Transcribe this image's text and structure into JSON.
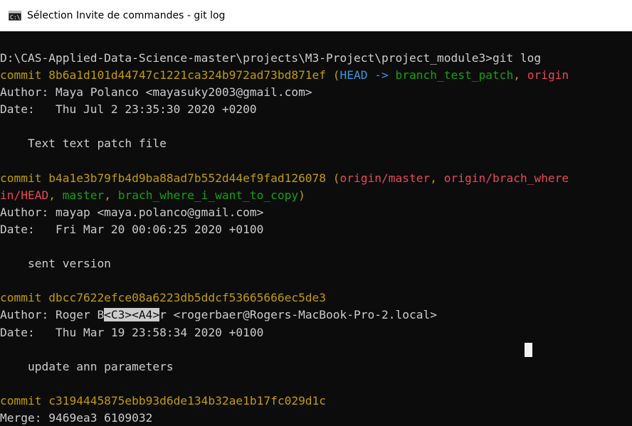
{
  "window": {
    "title": "Sélection Invite de commandes - git  log",
    "icon": "cmd-icon"
  },
  "console": {
    "lines": [
      {
        "segments": [
          {
            "text": "D:\\CAS-Applied-Data-Science-master\\projects\\M3-Project\\project_module3>git log",
            "color": "gray"
          }
        ]
      },
      {
        "segments": [
          {
            "text": "commit 8b6a1d101d44747c1221ca324b972ad73bd871ef ",
            "color": "yellow"
          },
          {
            "text": "(",
            "color": "yellow"
          },
          {
            "text": "HEAD -> ",
            "color": "cyan"
          },
          {
            "text": "branch_test_patch",
            "color": "green"
          },
          {
            "text": ", ",
            "color": "yellow"
          },
          {
            "text": "origin",
            "color": "red"
          }
        ]
      },
      {
        "segments": [
          {
            "text": "Author: Maya Polanco <mayasuky2003@gmail.com>",
            "color": "gray"
          }
        ]
      },
      {
        "segments": [
          {
            "text": "Date:   Thu Jul 2 23:35:30 2020 +0200",
            "color": "gray"
          }
        ]
      },
      {
        "segments": [
          {
            "text": "",
            "color": "gray"
          }
        ]
      },
      {
        "segments": [
          {
            "text": "    Text text patch file",
            "color": "gray"
          }
        ]
      },
      {
        "segments": [
          {
            "text": "",
            "color": "gray"
          }
        ]
      },
      {
        "segments": [
          {
            "text": "commit b4a1e3b79fb4d9ba88ad7b552d44ef9fad126078 ",
            "color": "yellow"
          },
          {
            "text": "(",
            "color": "yellow"
          },
          {
            "text": "origin/master",
            "color": "red"
          },
          {
            "text": ", ",
            "color": "yellow"
          },
          {
            "text": "origin/brach_where",
            "color": "red"
          }
        ]
      },
      {
        "segments": [
          {
            "text": "in/HEAD",
            "color": "red"
          },
          {
            "text": ", ",
            "color": "yellow"
          },
          {
            "text": "master",
            "color": "green"
          },
          {
            "text": ", ",
            "color": "yellow"
          },
          {
            "text": "brach_where_i_want_to_copy",
            "color": "green"
          },
          {
            "text": ")",
            "color": "yellow"
          }
        ]
      },
      {
        "segments": [
          {
            "text": "Author: mayap <maya.polanco@gmail.com>",
            "color": "gray"
          }
        ]
      },
      {
        "segments": [
          {
            "text": "Date:   Fri Mar 20 00:06:25 2020 +0100",
            "color": "gray"
          }
        ]
      },
      {
        "segments": [
          {
            "text": "",
            "color": "gray"
          }
        ]
      },
      {
        "segments": [
          {
            "text": "    sent version",
            "color": "gray"
          }
        ]
      },
      {
        "segments": [
          {
            "text": "",
            "color": "gray"
          }
        ]
      },
      {
        "segments": [
          {
            "text": "commit dbcc7622efce08a6223db5ddcf53665666ec5de3",
            "color": "yellow"
          }
        ]
      },
      {
        "segments": [
          {
            "text": "Author: Roger B",
            "color": "gray"
          },
          {
            "text": "<C3><A4>",
            "color": "sel"
          },
          {
            "text": "r <rogerbaer@Rogers-MacBook-Pro-2.local>",
            "color": "gray"
          }
        ]
      },
      {
        "segments": [
          {
            "text": "Date:   Thu Mar 19 23:58:34 2020 +0100",
            "color": "gray"
          }
        ]
      },
      {
        "segments": [
          {
            "text": "",
            "color": "gray"
          }
        ]
      },
      {
        "segments": [
          {
            "text": "    update ann parameters",
            "color": "gray"
          }
        ]
      },
      {
        "segments": [
          {
            "text": "",
            "color": "gray"
          }
        ]
      },
      {
        "segments": [
          {
            "text": "commit c3194445875ebb93d6de134b32ae1b17fc029d1c",
            "color": "yellow"
          }
        ]
      },
      {
        "segments": [
          {
            "text": "Merge: 9469ea3 6109032",
            "color": "gray"
          }
        ]
      }
    ]
  },
  "colors": {
    "background": "#0c0c0c",
    "default_text": "#cccccc",
    "yellow": "#c19c00",
    "cyan": "#3a96dd",
    "green": "#13a10e",
    "red": "#e74856",
    "selection_bg": "#cccccc"
  }
}
